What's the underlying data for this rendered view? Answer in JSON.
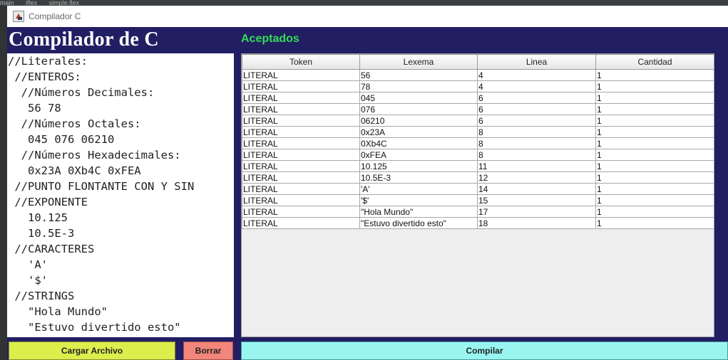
{
  "ide_background": {
    "tabs": [
      "main",
      "iflex",
      "simple.flex"
    ]
  },
  "window": {
    "title": "Compilador C"
  },
  "header": {
    "brand": "Compilador de C",
    "status_label": "Aceptados"
  },
  "editor": {
    "lines": [
      "//Literales:",
      " //ENTEROS:",
      "  //Números Decimales:",
      "   56 78",
      "  //Números Octales:",
      "   045 076 06210",
      "  //Números Hexadecimales:",
      "   0x23A 0Xb4C 0xFEA",
      " //PUNTO FLONTANTE CON Y SIN",
      " //EXPONENTE",
      "   10.125",
      "   10.5E-3",
      " //CARACTERES",
      "   'A'",
      "   '$'",
      " //STRINGS",
      "   \"Hola Mundo\"",
      "   \"Estuvo divertido esto\""
    ]
  },
  "table": {
    "columns": [
      "Token",
      "Lexema",
      "Linea",
      "Cantidad"
    ],
    "rows": [
      [
        "LITERAL",
        "56",
        "4",
        "1"
      ],
      [
        "LITERAL",
        "78",
        "4",
        "1"
      ],
      [
        "LITERAL",
        "045",
        "6",
        "1"
      ],
      [
        "LITERAL",
        "076",
        "6",
        "1"
      ],
      [
        "LITERAL",
        "06210",
        "6",
        "1"
      ],
      [
        "LITERAL",
        "0x23A",
        "8",
        "1"
      ],
      [
        "LITERAL",
        "0Xb4C",
        "8",
        "1"
      ],
      [
        "LITERAL",
        "0xFEA",
        "8",
        "1"
      ],
      [
        "LITERAL",
        "10.125",
        "11",
        "1"
      ],
      [
        "LITERAL",
        "10.5E-3",
        "12",
        "1"
      ],
      [
        "LITERAL",
        "'A'",
        "14",
        "1"
      ],
      [
        "LITERAL",
        "'$'",
        "15",
        "1"
      ],
      [
        "LITERAL",
        "\"Hola Mundo\"",
        "17",
        "1"
      ],
      [
        "LITERAL",
        "\"Estuvo divertido esto\"",
        "18",
        "1"
      ]
    ]
  },
  "buttons": {
    "load": "Cargar Archivo",
    "clear": "Borrar",
    "compile": "Compilar"
  },
  "colors": {
    "panel_background": "#221e63",
    "accepted_label": "#33dd55",
    "load_button": "#dbee4c",
    "clear_button": "#f2867a",
    "compile_button": "#99f5f0"
  }
}
